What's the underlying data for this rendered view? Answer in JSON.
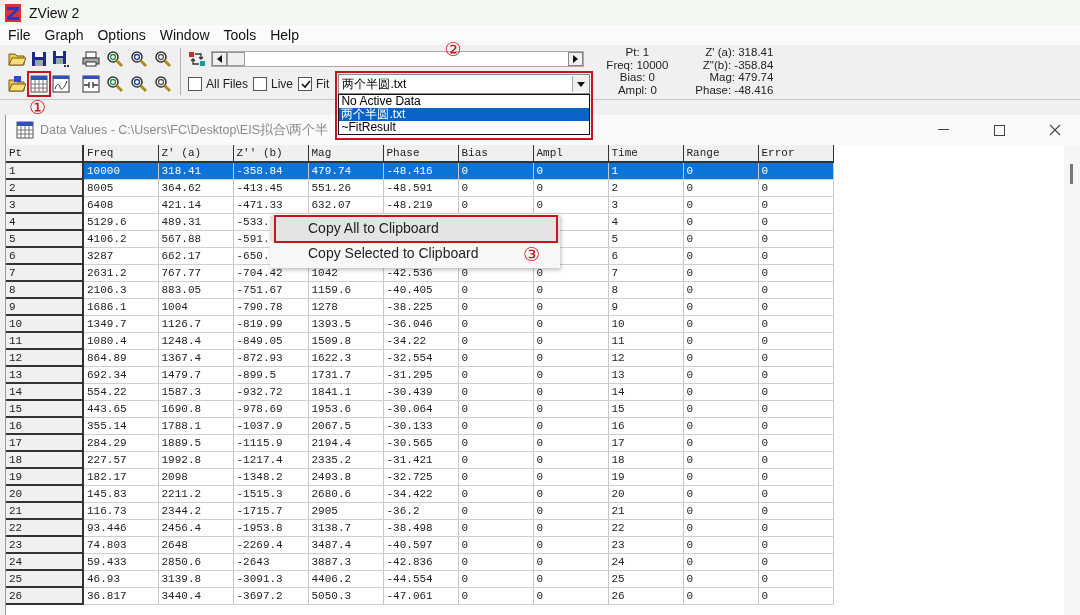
{
  "window": {
    "title": "ZView 2"
  },
  "menu": [
    "File",
    "Graph",
    "Options",
    "Window",
    "Tools",
    "Help"
  ],
  "toolbar": {
    "checkboxes": [
      {
        "label": "All Files",
        "checked": false
      },
      {
        "label": "Live",
        "checked": false
      },
      {
        "label": "Fit",
        "checked": true
      }
    ],
    "file_select": {
      "value": "两个半圆.txt",
      "expanded": true,
      "options": [
        {
          "label": "No Active Data",
          "selected": false
        },
        {
          "label": "两个半圆.txt",
          "selected": true
        },
        {
          "label": "~FitResult",
          "selected": false
        }
      ]
    }
  },
  "readout": {
    "left": [
      "Pt: 1",
      "Freq: 10000",
      "Bias: 0",
      "Ampl: 0"
    ],
    "right": [
      "Z' (a): 318.41",
      "Z\"(b): -358.84",
      "Mag: 479.74",
      "Phase: -48.416"
    ]
  },
  "data_window": {
    "title": "Data Values - C:\\Users\\FC\\Desktop\\EIS拟合\\两个半",
    "table": {
      "columns": [
        "Pt",
        "Freq",
        "Z' (a)",
        "Z'' (b)",
        "Mag",
        "Phase",
        "Bias",
        "Ampl",
        "Time",
        "Range",
        "Error"
      ],
      "rows": [
        {
          "selected": true,
          "cells": [
            "1",
            "10000",
            "318.41",
            "-358.84",
            "479.74",
            "-48.416",
            "0",
            "0",
            "1",
            "0",
            "0"
          ]
        },
        {
          "selected": false,
          "cells": [
            "2",
            "8005",
            "364.62",
            "-413.45",
            "551.26",
            "-48.591",
            "0",
            "0",
            "2",
            "0",
            "0"
          ]
        },
        {
          "selected": false,
          "cells": [
            "3",
            "6408",
            "421.14",
            "-471.33",
            "632.07",
            "-48.219",
            "0",
            "0",
            "3",
            "0",
            "0"
          ]
        },
        {
          "selected": false,
          "cells": [
            "4",
            "5129.6",
            "489.31",
            "-533.",
            null,
            null,
            null,
            null,
            "4",
            "0",
            "0"
          ]
        },
        {
          "selected": false,
          "cells": [
            "5",
            "4106.2",
            "567.88",
            "-591.",
            null,
            null,
            null,
            null,
            "5",
            "0",
            "0"
          ]
        },
        {
          "selected": false,
          "cells": [
            "6",
            "3287",
            "662.17",
            "-650.",
            null,
            null,
            null,
            null,
            "6",
            "0",
            "0"
          ]
        },
        {
          "selected": false,
          "cells": [
            "7",
            "2631.2",
            "767.77",
            "-704.42",
            "1042",
            "-42.536",
            "0",
            "0",
            "7",
            "0",
            "0"
          ]
        },
        {
          "selected": false,
          "cells": [
            "8",
            "2106.3",
            "883.05",
            "-751.67",
            "1159.6",
            "-40.405",
            "0",
            "0",
            "8",
            "0",
            "0"
          ]
        },
        {
          "selected": false,
          "cells": [
            "9",
            "1686.1",
            "1004",
            "-790.78",
            "1278",
            "-38.225",
            "0",
            "0",
            "9",
            "0",
            "0"
          ]
        },
        {
          "selected": false,
          "cells": [
            "10",
            "1349.7",
            "1126.7",
            "-819.99",
            "1393.5",
            "-36.046",
            "0",
            "0",
            "10",
            "0",
            "0"
          ]
        },
        {
          "selected": false,
          "cells": [
            "11",
            "1080.4",
            "1248.4",
            "-849.05",
            "1509.8",
            "-34.22",
            "0",
            "0",
            "11",
            "0",
            "0"
          ]
        },
        {
          "selected": false,
          "cells": [
            "12",
            "864.89",
            "1367.4",
            "-872.93",
            "1622.3",
            "-32.554",
            "0",
            "0",
            "12",
            "0",
            "0"
          ]
        },
        {
          "selected": false,
          "cells": [
            "13",
            "692.34",
            "1479.7",
            "-899.5",
            "1731.7",
            "-31.295",
            "0",
            "0",
            "13",
            "0",
            "0"
          ]
        },
        {
          "selected": false,
          "cells": [
            "14",
            "554.22",
            "1587.3",
            "-932.72",
            "1841.1",
            "-30.439",
            "0",
            "0",
            "14",
            "0",
            "0"
          ]
        },
        {
          "selected": false,
          "cells": [
            "15",
            "443.65",
            "1690.8",
            "-978.69",
            "1953.6",
            "-30.064",
            "0",
            "0",
            "15",
            "0",
            "0"
          ]
        },
        {
          "selected": false,
          "cells": [
            "16",
            "355.14",
            "1788.1",
            "-1037.9",
            "2067.5",
            "-30.133",
            "0",
            "0",
            "16",
            "0",
            "0"
          ]
        },
        {
          "selected": false,
          "cells": [
            "17",
            "284.29",
            "1889.5",
            "-1115.9",
            "2194.4",
            "-30.565",
            "0",
            "0",
            "17",
            "0",
            "0"
          ]
        },
        {
          "selected": false,
          "cells": [
            "18",
            "227.57",
            "1992.8",
            "-1217.4",
            "2335.2",
            "-31.421",
            "0",
            "0",
            "18",
            "0",
            "0"
          ]
        },
        {
          "selected": false,
          "cells": [
            "19",
            "182.17",
            "2098",
            "-1348.2",
            "2493.8",
            "-32.725",
            "0",
            "0",
            "19",
            "0",
            "0"
          ]
        },
        {
          "selected": false,
          "cells": [
            "20",
            "145.83",
            "2211.2",
            "-1515.3",
            "2680.6",
            "-34.422",
            "0",
            "0",
            "20",
            "0",
            "0"
          ]
        },
        {
          "selected": false,
          "cells": [
            "21",
            "116.73",
            "2344.2",
            "-1715.7",
            "2905",
            "-36.2",
            "0",
            "0",
            "21",
            "0",
            "0"
          ]
        },
        {
          "selected": false,
          "cells": [
            "22",
            "93.446",
            "2456.4",
            "-1953.8",
            "3138.7",
            "-38.498",
            "0",
            "0",
            "22",
            "0",
            "0"
          ]
        },
        {
          "selected": false,
          "cells": [
            "23",
            "74.803",
            "2648",
            "-2269.4",
            "3487.4",
            "-40.597",
            "0",
            "0",
            "23",
            "0",
            "0"
          ]
        },
        {
          "selected": false,
          "cells": [
            "24",
            "59.433",
            "2850.6",
            "-2643",
            "3887.3",
            "-42.836",
            "0",
            "0",
            "24",
            "0",
            "0"
          ]
        },
        {
          "selected": false,
          "cells": [
            "25",
            "46.93",
            "3139.8",
            "-3091.3",
            "4406.2",
            "-44.554",
            "0",
            "0",
            "25",
            "0",
            "0"
          ]
        },
        {
          "selected": false,
          "cells": [
            "26",
            "36.817",
            "3440.4",
            "-3697.2",
            "5050.3",
            "-47.061",
            "0",
            "0",
            "26",
            "0",
            "0"
          ]
        }
      ]
    }
  },
  "context_menu": {
    "items": [
      {
        "label": "Copy All to Clipboard",
        "highlighted": true
      },
      {
        "label": "Copy Selected to Clipboard",
        "highlighted": false
      }
    ]
  },
  "annotations": [
    {
      "label": "①"
    },
    {
      "label": "②"
    },
    {
      "label": "③"
    }
  ]
}
